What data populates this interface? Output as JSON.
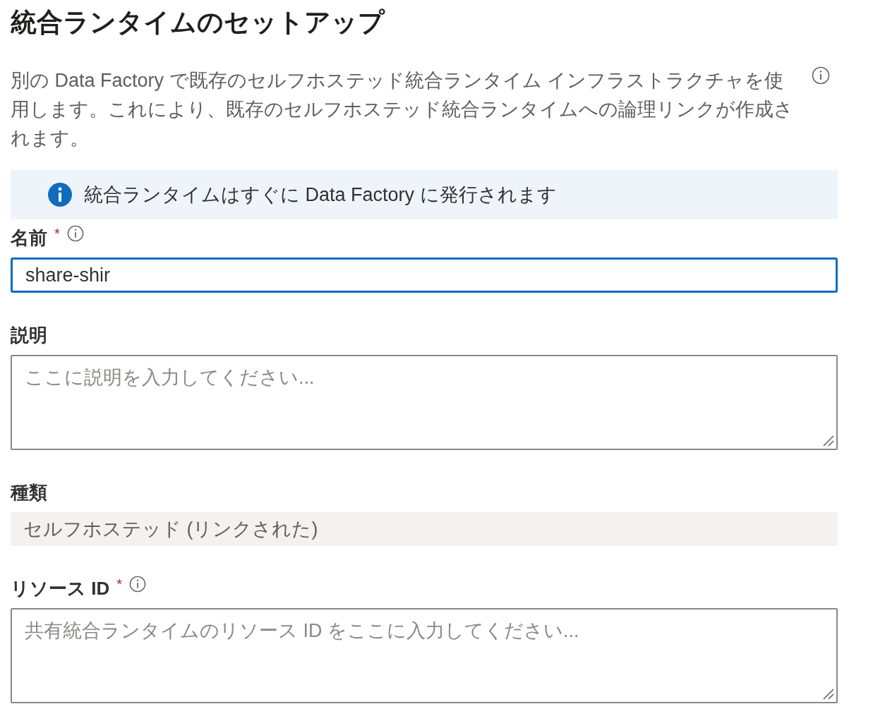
{
  "title": "統合ランタイムのセットアップ",
  "description": "別の Data Factory で既存のセルフホステッド統合ランタイム インフラストラクチャを使用します。これにより、既存のセルフホステッド統合ランタイムへの論理リンクが作成されます。",
  "info_banner": {
    "text": "統合ランタイムはすぐに Data Factory に発行されます"
  },
  "fields": [
    {
      "kind": "text",
      "label": "名前",
      "required_mark": "*",
      "has_info": true,
      "focused": true,
      "value": "share-shir"
    },
    {
      "kind": "textarea",
      "label": "説明",
      "has_info": false,
      "focused": false,
      "placeholder": "ここに説明を入力してください..."
    },
    {
      "kind": "readonly",
      "label": "種類",
      "has_info": false,
      "value": "セルフホステッド (リンクされた)"
    },
    {
      "kind": "textarea",
      "label": "リソース ID",
      "required_mark": "*",
      "has_info": true,
      "focused": false,
      "placeholder": "共有統合ランタイムのリソース ID をここに入力してください..."
    }
  ]
}
